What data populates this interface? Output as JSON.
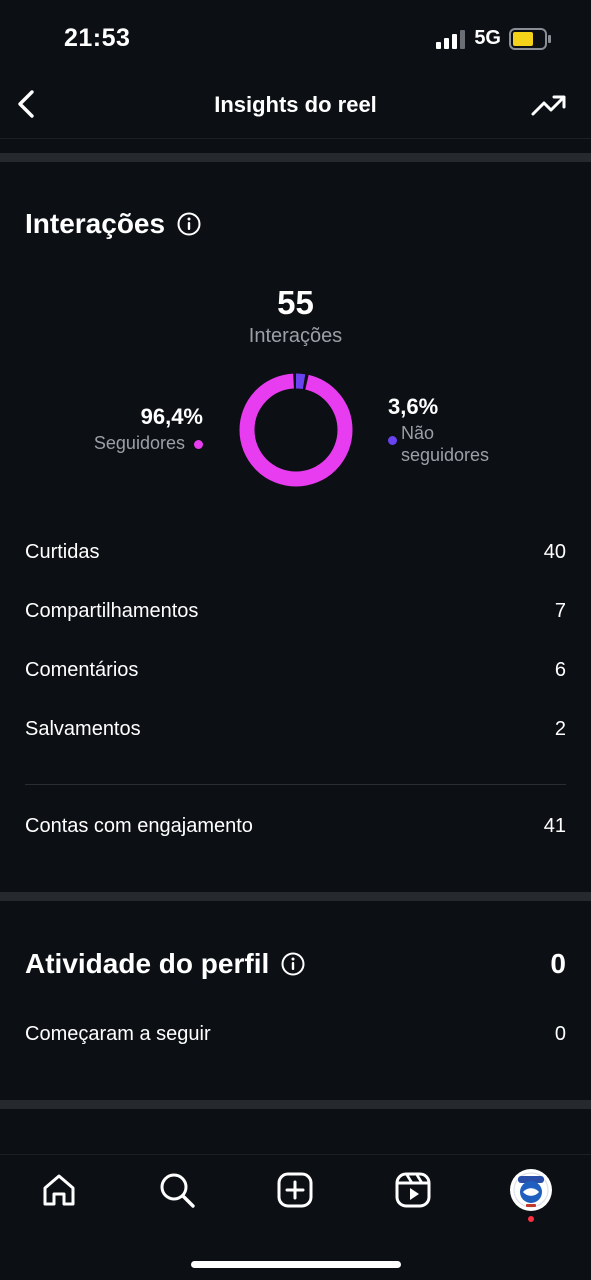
{
  "status_bar": {
    "time": "21:53",
    "network": "5G",
    "icons": [
      "signal-icon",
      "battery-icon"
    ]
  },
  "header": {
    "title": "Insights do reel",
    "icons": [
      "back-arrow-icon",
      "trending-up-icon"
    ]
  },
  "interactions": {
    "title": "Interações",
    "total": "55",
    "total_label": "Interações",
    "followers_pct": "96,4%",
    "followers_label": "Seguidores",
    "nonfollowers_pct": "3,6%",
    "nonfollowers_label_line1": "Não",
    "nonfollowers_label_line2": "seguidores",
    "followers_share": 0.964,
    "nonfollowers_share": 0.036,
    "colors": {
      "followers": "#e83cf0",
      "nonfollowers": "#6a43f0"
    },
    "rows": [
      {
        "label": "Curtidas",
        "value": "40"
      },
      {
        "label": "Compartilhamentos",
        "value": "7"
      },
      {
        "label": "Comentários",
        "value": "6"
      },
      {
        "label": "Salvamentos",
        "value": "2"
      }
    ],
    "engaged_label": "Contas com engajamento",
    "engaged_value": "41"
  },
  "profile_activity": {
    "title": "Atividade do perfil",
    "value": "0",
    "rows": [
      {
        "label": "Começaram a seguir",
        "value": "0"
      }
    ]
  },
  "bottom_nav": {
    "items": [
      "home-icon",
      "search-icon",
      "create-icon",
      "reels-icon",
      "profile-avatar"
    ]
  }
}
